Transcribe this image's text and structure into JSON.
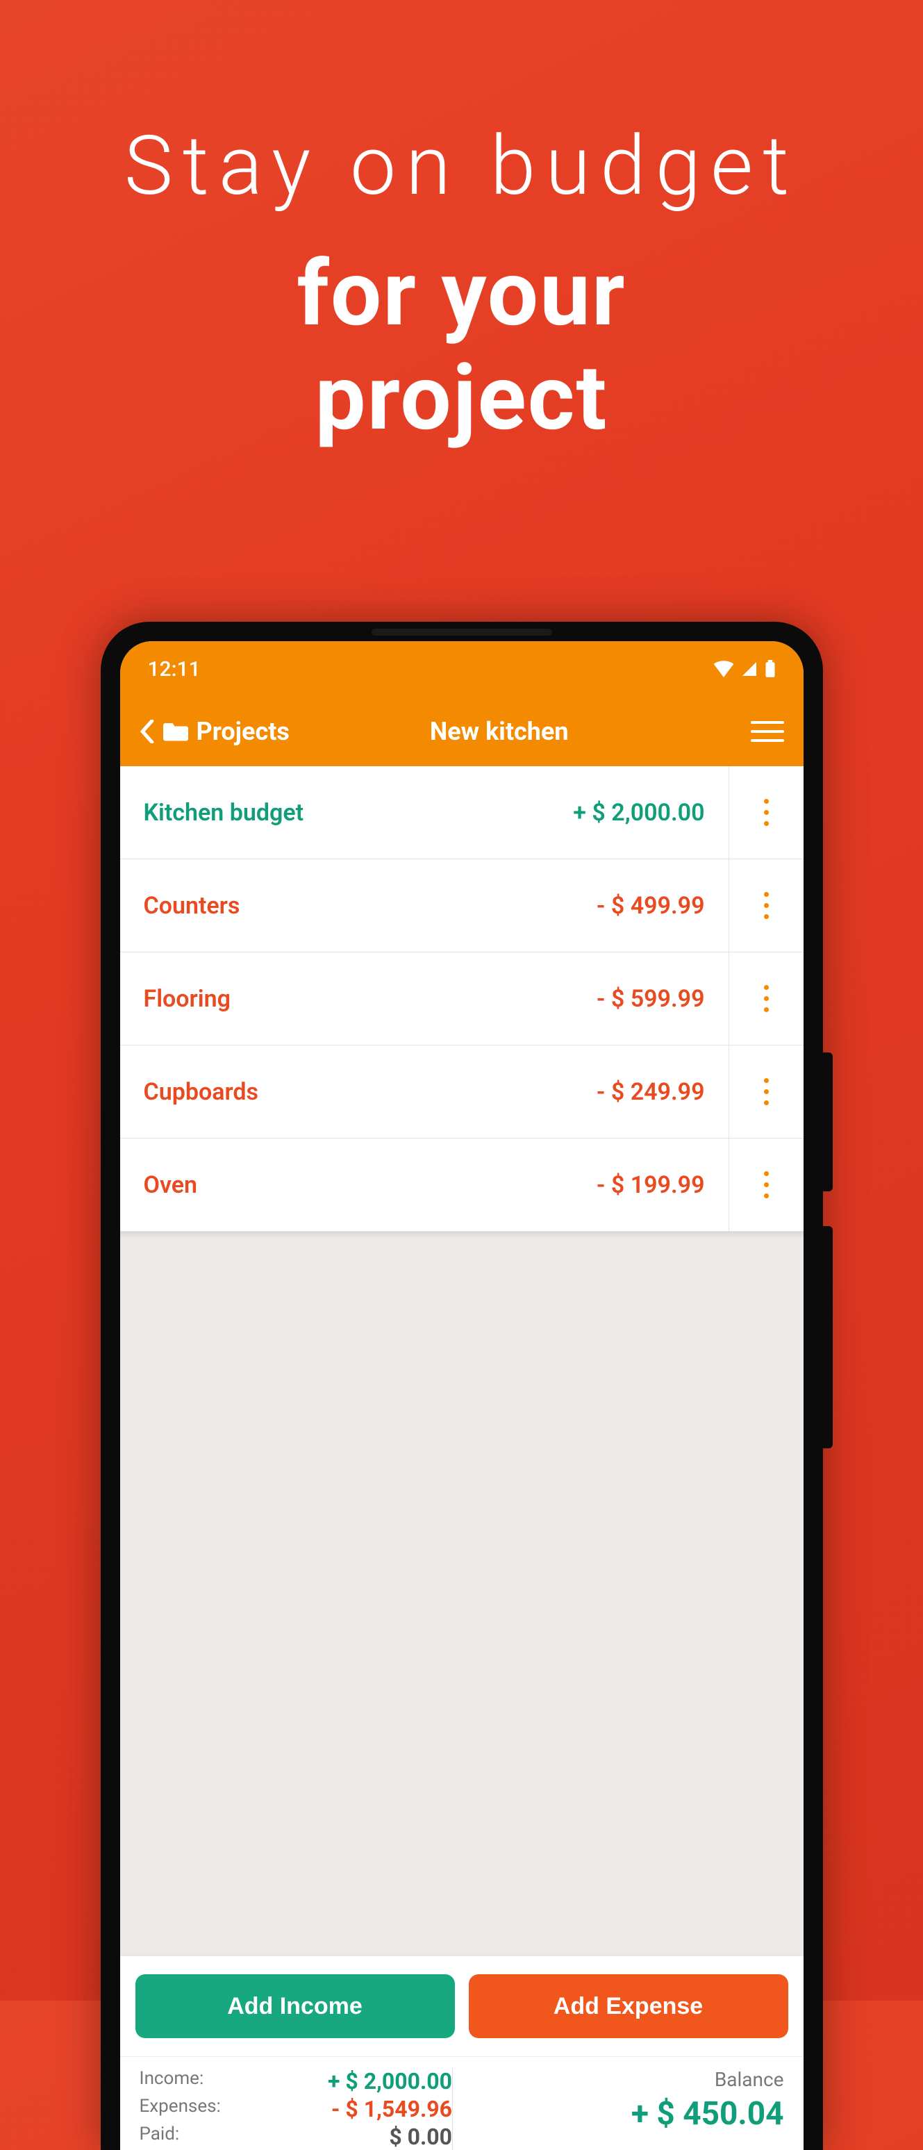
{
  "promo": {
    "line1": "Stay on budget",
    "line2a": "for your",
    "line2b": "project"
  },
  "status": {
    "time": "12:11"
  },
  "nav": {
    "back_label": "Projects",
    "title": "New kitchen"
  },
  "items": [
    {
      "name": "Kitchen budget",
      "amount": "+ $ 2,000.00",
      "kind": "income"
    },
    {
      "name": "Counters",
      "amount": "- $ 499.99",
      "kind": "expense"
    },
    {
      "name": "Flooring",
      "amount": "- $ 599.99",
      "kind": "expense"
    },
    {
      "name": "Cupboards",
      "amount": "- $ 249.99",
      "kind": "expense"
    },
    {
      "name": "Oven",
      "amount": "- $ 199.99",
      "kind": "expense"
    }
  ],
  "actions": {
    "add_income": "Add Income",
    "add_expense": "Add Expense"
  },
  "summary": {
    "income_label": "Income:",
    "income_value": "+ $ 2,000.00",
    "expenses_label": "Expenses:",
    "expenses_value": "- $ 1,549.96",
    "paid_label": "Paid:",
    "paid_value": "$ 0.00",
    "balance_label": "Balance",
    "balance_value": "+ $ 450.04"
  },
  "colors": {
    "income": "#0f9d7a",
    "expense": "#ea4a1f"
  }
}
